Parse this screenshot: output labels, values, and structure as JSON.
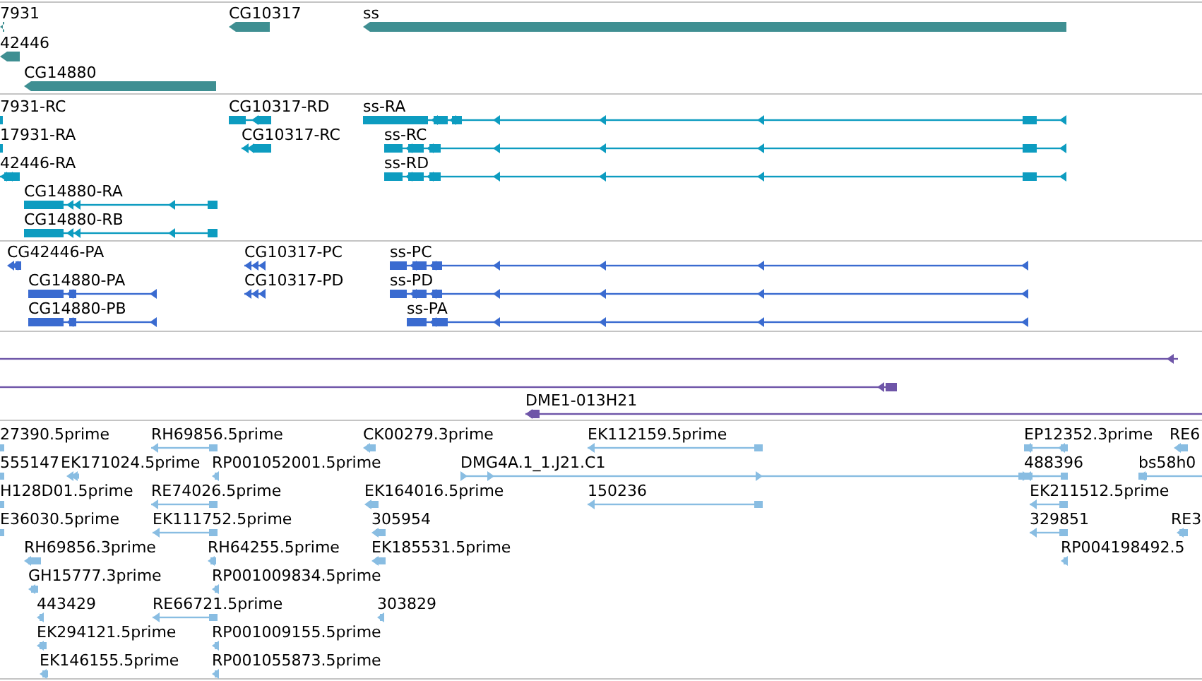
{
  "tracks": [
    {
      "kind": "gene",
      "features": [
        {
          "label": "7931"
        },
        {
          "label": "42446"
        },
        {
          "label": "CG14880"
        },
        {
          "label": "CG10317"
        },
        {
          "label": "ss"
        }
      ]
    },
    {
      "kind": "transcript",
      "features": [
        {
          "label": "7931-RC"
        },
        {
          "label": "17931-RA"
        },
        {
          "label": "42446-RA"
        },
        {
          "label": "CG14880-RA"
        },
        {
          "label": "CG14880-RB"
        },
        {
          "label": "CG10317-RD"
        },
        {
          "label": "CG10317-RC"
        },
        {
          "label": "ss-RA"
        },
        {
          "label": "ss-RC"
        },
        {
          "label": "ss-RD"
        }
      ]
    },
    {
      "kind": "protein",
      "features": [
        {
          "label": "CG42446-PA"
        },
        {
          "label": "CG14880-PA"
        },
        {
          "label": "CG14880-PB"
        },
        {
          "label": "CG10317-PC"
        },
        {
          "label": "CG10317-PD"
        },
        {
          "label": "ss-PC"
        },
        {
          "label": "ss-PD"
        },
        {
          "label": "ss-PA"
        }
      ]
    },
    {
      "kind": "clone",
      "features": [
        {
          "kind": "unlabeled"
        },
        {
          "kind": "unlabeled"
        },
        {
          "kind": "labeled",
          "label": "DME1-013H21"
        }
      ]
    },
    {
      "kind": "est",
      "features": [
        {
          "label": "27390.5prime"
        },
        {
          "label": "RH69856.5prime"
        },
        {
          "label": "CK00279.3prime"
        },
        {
          "label": "EK112159.5prime"
        },
        {
          "label": "EP12352.3prime"
        },
        {
          "label": "RE6"
        },
        {
          "label": "555147"
        },
        {
          "label": "EK171024.5prime"
        },
        {
          "label": "RP001052001.5prime"
        },
        {
          "label": "DMG4A.1_1.J21.C1"
        },
        {
          "label": "488396"
        },
        {
          "label": "bs58h0"
        },
        {
          "label": "H128D01.5prime"
        },
        {
          "label": "RE74026.5prime"
        },
        {
          "label": "EK164016.5prime"
        },
        {
          "label": "150236"
        },
        {
          "label": "EK211512.5prime"
        },
        {
          "label": "E36030.5prime"
        },
        {
          "label": "EK111752.5prime"
        },
        {
          "label": "305954"
        },
        {
          "label": "329851"
        },
        {
          "label": "RE3"
        },
        {
          "label": "RH69856.3prime"
        },
        {
          "label": "RH64255.5prime"
        },
        {
          "label": "EK185531.5prime"
        },
        {
          "label": "RP004198492.5"
        },
        {
          "label": "GH15777.3prime"
        },
        {
          "label": "RP001009834.5prime"
        },
        {
          "label": "443429"
        },
        {
          "label": "RE66721.5prime"
        },
        {
          "label": "303829"
        },
        {
          "label": "EK294121.5prime"
        },
        {
          "label": "RP001009155.5prime"
        },
        {
          "label": "EK146155.5prime"
        },
        {
          "label": "RP001055873.5prime"
        }
      ]
    }
  ]
}
